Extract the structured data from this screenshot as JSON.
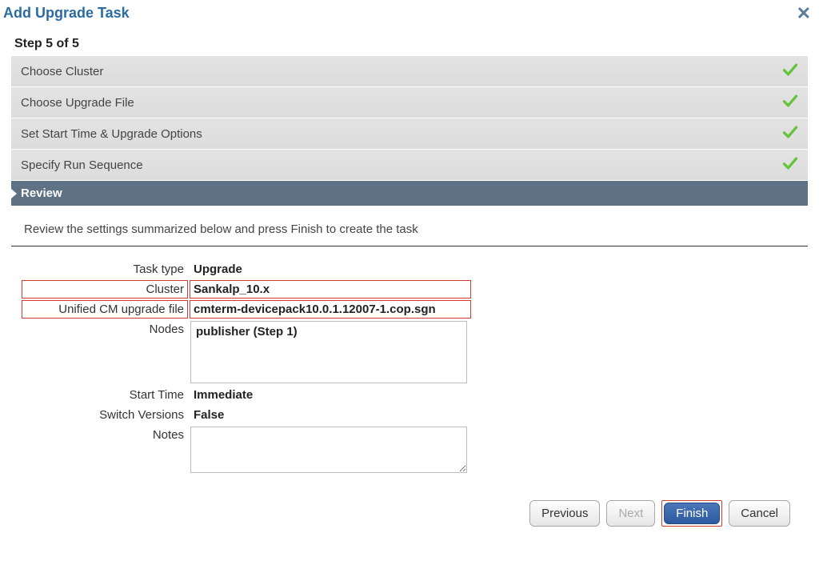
{
  "dialog": {
    "title": "Add Upgrade Task",
    "step_indicator": "Step 5 of 5"
  },
  "steps": {
    "choose_cluster": "Choose Cluster",
    "choose_upgrade_file": "Choose Upgrade File",
    "set_start_time": "Set Start Time & Upgrade Options",
    "specify_run_sequence": "Specify Run Sequence",
    "review": "Review"
  },
  "review": {
    "instruction": "Review the settings summarized below and press Finish to create the task",
    "labels": {
      "task_type": "Task type",
      "cluster": "Cluster",
      "upgrade_file": "Unified CM upgrade file",
      "nodes": "Nodes",
      "start_time": "Start Time",
      "switch_versions": "Switch Versions",
      "notes": "Notes"
    },
    "values": {
      "task_type": "Upgrade",
      "cluster": "Sankalp_10.x",
      "upgrade_file": "cmterm-devicepack10.0.1.12007-1.cop.sgn",
      "nodes": "publisher (Step 1)",
      "start_time": "Immediate",
      "switch_versions": "False",
      "notes": ""
    }
  },
  "buttons": {
    "previous": "Previous",
    "next": "Next",
    "finish": "Finish",
    "cancel": "Cancel"
  }
}
